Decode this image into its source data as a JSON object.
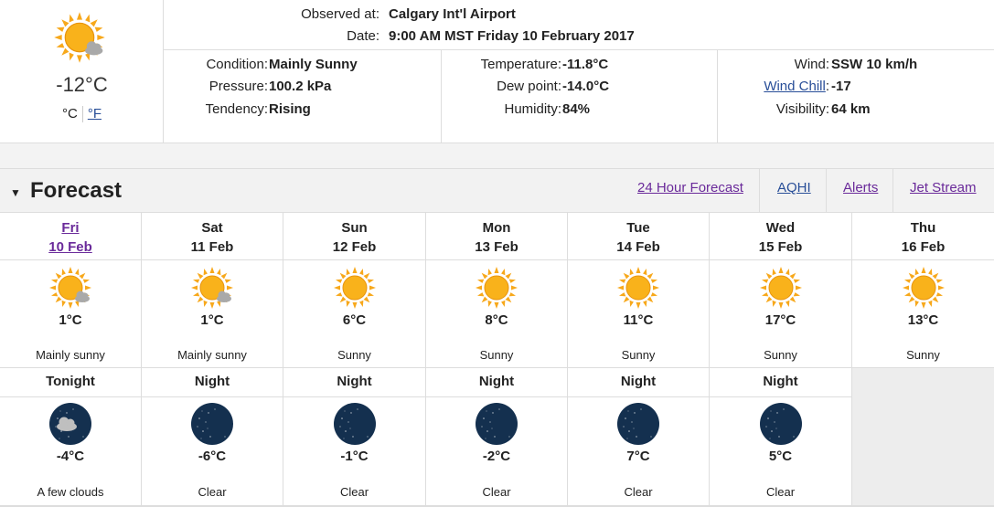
{
  "current": {
    "icon": "sun-with-cloud-icon",
    "temperature": "-12°C",
    "unit_c": "°C",
    "unit_f": "°F",
    "observed_label": "Observed at:",
    "observed_value": "Calgary Int'l Airport",
    "date_label": "Date:",
    "date_value": "9:00 AM MST Friday 10 February 2017",
    "condition_label": "Condition:",
    "condition_value": "Mainly Sunny",
    "pressure_label": "Pressure:",
    "pressure_value": "100.2 kPa",
    "tendency_label": "Tendency:",
    "tendency_value": "Rising",
    "temperature_label": "Temperature:",
    "temperature_value": "-11.8°C",
    "dewpoint_label": "Dew point:",
    "dewpoint_value": "-14.0°C",
    "humidity_label": "Humidity:",
    "humidity_value": "84%",
    "wind_label": "Wind:",
    "wind_value": "SSW 10 km/h",
    "windchill_label": "Wind Chill",
    "windchill_colon": ":",
    "windchill_value": "-17",
    "visibility_label": "Visibility:",
    "visibility_value": "64 km"
  },
  "forecast": {
    "title": "Forecast",
    "links": {
      "hourly": "24 Hour Forecast",
      "aqhi": "AQHI",
      "alerts": "Alerts",
      "jet_stream": "Jet Stream"
    },
    "days": [
      {
        "day": "Fri",
        "date": "10 Feb",
        "icon": "sun-with-cloud-icon",
        "temp": "1°C",
        "summary": "Mainly sunny",
        "night_label": "Tonight",
        "night_icon": "moon-with-cloud-icon",
        "night_temp": "-4°C",
        "night_summary": "A few clouds"
      },
      {
        "day": "Sat",
        "date": "11 Feb",
        "icon": "sun-with-cloud-icon",
        "temp": "1°C",
        "summary": "Mainly sunny",
        "night_label": "Night",
        "night_icon": "moon-icon",
        "night_temp": "-6°C",
        "night_summary": "Clear"
      },
      {
        "day": "Sun",
        "date": "12 Feb",
        "icon": "sun-icon",
        "temp": "6°C",
        "summary": "Sunny",
        "night_label": "Night",
        "night_icon": "moon-icon",
        "night_temp": "-1°C",
        "night_summary": "Clear"
      },
      {
        "day": "Mon",
        "date": "13 Feb",
        "icon": "sun-icon",
        "temp": "8°C",
        "summary": "Sunny",
        "night_label": "Night",
        "night_icon": "moon-icon",
        "night_temp": "-2°C",
        "night_summary": "Clear"
      },
      {
        "day": "Tue",
        "date": "14 Feb",
        "icon": "sun-icon",
        "temp": "11°C",
        "summary": "Sunny",
        "night_label": "Night",
        "night_icon": "moon-icon",
        "night_temp": "7°C",
        "night_summary": "Clear"
      },
      {
        "day": "Wed",
        "date": "15 Feb",
        "icon": "sun-icon",
        "temp": "17°C",
        "summary": "Sunny",
        "night_label": "Night",
        "night_icon": "moon-icon",
        "night_temp": "5°C",
        "night_summary": "Clear"
      },
      {
        "day": "Thu",
        "date": "16 Feb",
        "icon": "sun-icon",
        "temp": "13°C",
        "summary": "Sunny"
      }
    ]
  },
  "colors": {
    "sun": "#f7a81b",
    "moon_bg": "#14304f",
    "moon": "#f3eec4",
    "link": "#6a2a9a",
    "link_blue": "#284e98"
  }
}
